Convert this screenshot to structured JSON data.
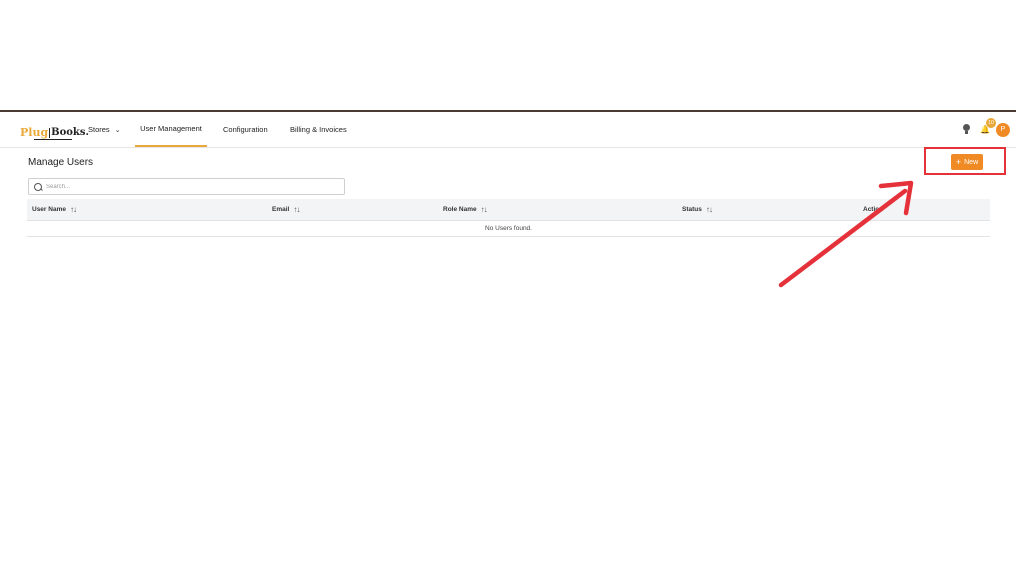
{
  "brand": {
    "logo_part1": "Plug",
    "logo_part2": "Books."
  },
  "nav": {
    "items": [
      {
        "label": "Stores",
        "has_dropdown": true
      },
      {
        "label": "User Management",
        "active": true
      },
      {
        "label": "Configuration"
      },
      {
        "label": "Billing & Invoices"
      }
    ],
    "dropdown_glyph": "⌄"
  },
  "header_icons": {
    "notification_count": "10",
    "avatar_initial": "P",
    "bell_glyph": "🔔"
  },
  "page": {
    "title": "Manage Users",
    "new_button_label": "New",
    "new_button_plus": "+"
  },
  "search": {
    "placeholder": "Search..."
  },
  "table": {
    "sort_glyph": "↑↓",
    "columns": [
      "User Name",
      "Email",
      "Role Name",
      "Status",
      "Action"
    ],
    "empty_message": "No Users found."
  },
  "colors": {
    "accent": "#f08a24",
    "annotation": "#e5323a",
    "logo_orange": "#e8a93a"
  },
  "icons": [
    "lightbulb-icon",
    "bell-icon",
    "search-icon",
    "sort-icon",
    "chevron-down-icon",
    "plus-icon"
  ]
}
